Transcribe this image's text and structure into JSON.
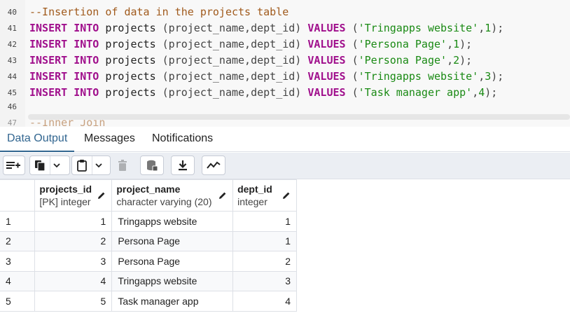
{
  "editor": {
    "lines": [
      {
        "number": "40",
        "comment": "--Insertion of data in the projects table"
      },
      {
        "number": "41",
        "kw1": "INSERT",
        "kw2": "INTO",
        "table": "projects",
        "cols": "(project_name,dept_id)",
        "kw3": "VALUES",
        "value": "'Tringapps website'",
        "id": "1"
      },
      {
        "number": "42",
        "kw1": "INSERT",
        "kw2": "INTO",
        "table": "projects",
        "cols": "(project_name,dept_id)",
        "kw3": "VALUES",
        "value": "'Persona Page'",
        "id": "1"
      },
      {
        "number": "43",
        "kw1": "INSERT",
        "kw2": "INTO",
        "table": "projects",
        "cols": "(project_name,dept_id)",
        "kw3": "VALUES",
        "value": "'Persona Page'",
        "id": "2"
      },
      {
        "number": "44",
        "kw1": "INSERT",
        "kw2": "INTO",
        "table": "projects",
        "cols": "(project_name,dept_id)",
        "kw3": "VALUES",
        "value": "'Tringapps website'",
        "id": "3"
      },
      {
        "number": "45",
        "kw1": "INSERT",
        "kw2": "INTO",
        "table": "projects",
        "cols": "(project_name,dept_id)",
        "kw3": "VALUES",
        "value": "'Task manager app'",
        "id": "4"
      },
      {
        "number": "46"
      },
      {
        "number": "47",
        "comment": "--Inner Join"
      }
    ]
  },
  "tabs": [
    {
      "label": "Data Output",
      "active": true
    },
    {
      "label": "Messages",
      "active": false
    },
    {
      "label": "Notifications",
      "active": false
    }
  ],
  "toolbar": {
    "icons": [
      "add-row-icon",
      "copy-icon",
      "chevron-down-icon",
      "paste-icon",
      "chevron-down-icon",
      "delete-icon",
      "save-data-icon",
      "download-icon",
      "graph-visualiser-icon"
    ]
  },
  "grid": {
    "columns": [
      {
        "name": "projects_id",
        "type": "[PK] integer"
      },
      {
        "name": "project_name",
        "type": "character varying (20)"
      },
      {
        "name": "dept_id",
        "type": "integer"
      }
    ],
    "rows": [
      {
        "row": "1",
        "projects_id": "1",
        "project_name": "Tringapps website",
        "dept_id": "1"
      },
      {
        "row": "2",
        "projects_id": "2",
        "project_name": "Persona Page",
        "dept_id": "1"
      },
      {
        "row": "3",
        "projects_id": "3",
        "project_name": "Persona Page",
        "dept_id": "2"
      },
      {
        "row": "4",
        "projects_id": "4",
        "project_name": "Tringapps website",
        "dept_id": "3"
      },
      {
        "row": "5",
        "projects_id": "5",
        "project_name": "Task manager app",
        "dept_id": "4"
      }
    ]
  },
  "colors": {
    "keyword": "#a00f8c",
    "comment": "#a05a1c",
    "string": "#1a8a14",
    "tab_active": "#326690"
  }
}
